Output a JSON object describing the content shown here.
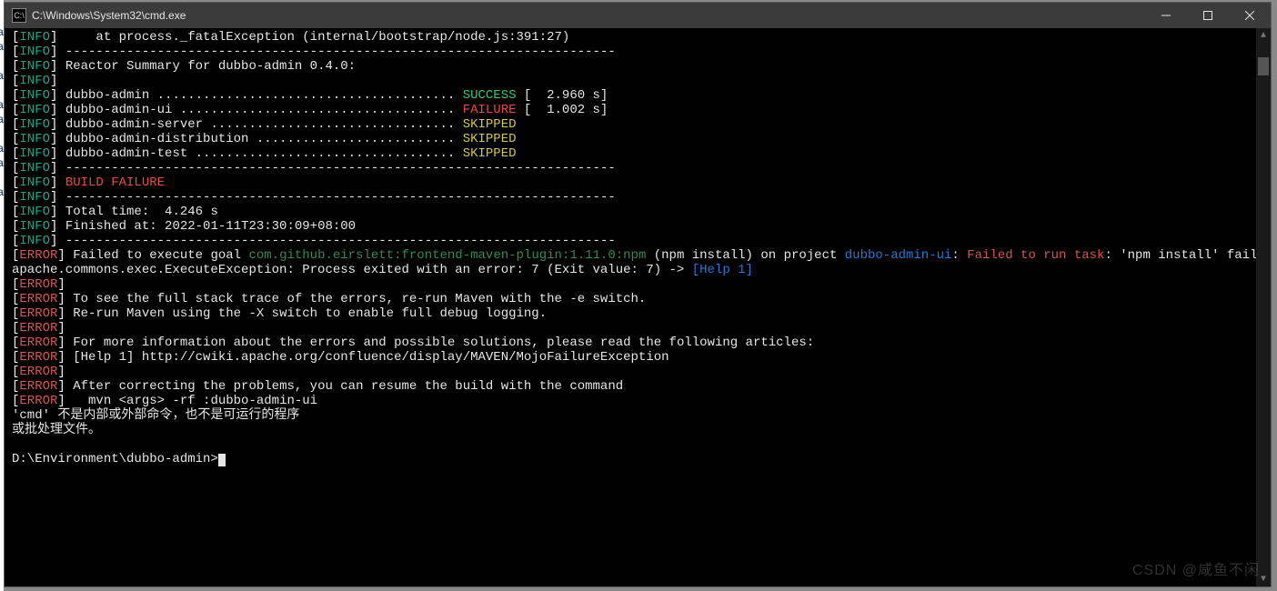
{
  "window": {
    "title": "C:\\Windows\\System32\\cmd.exe",
    "icon_label": "C:\\"
  },
  "tags": {
    "info_open": "[",
    "info": "INFO",
    "info_close": "]",
    "error_open": "[",
    "error": "ERROR",
    "error_close": "]"
  },
  "lines": {
    "l1": "     at process._fatalException (internal/bootstrap/node.js:391:27)",
    "l3": " Reactor Summary for dubbo-admin 0.4.0:",
    "mod1_name": " dubbo-admin ....................................... ",
    "mod1_status": "SUCCESS",
    "mod1_time": " [  2.960 s]",
    "mod2_name": " dubbo-admin-ui .................................... ",
    "mod2_status": "FAILURE",
    "mod2_time": " [  1.002 s]",
    "mod3_name": " dubbo-admin-server ................................ ",
    "mod3_status": "SKIPPED",
    "mod4_name": " dubbo-admin-distribution .......................... ",
    "mod4_status": "SKIPPED",
    "mod5_name": " dubbo-admin-test .................................. ",
    "mod5_status": "SKIPPED",
    "sep": " ------------------------------------------------------------------------",
    "build_failure": " BUILD FAILURE",
    "total_time": " Total time:  4.246 s",
    "finished_at": " Finished at: 2022-01-11T23:30:09+08:00",
    "err1_a": " Failed to execute goal ",
    "err1_plugin": "com.github.eirslett:frontend-maven-plugin:1.11.0:npm",
    "err1_b": " (npm install) on project ",
    "err1_project": "dubbo-admin-ui",
    "err1_c": ": ",
    "err1_task": "Failed to run task",
    "err1_d": ": 'npm install' failed. org.",
    "err1_line2a": "apache.commons.exec.ExecuteException: Process exited with an error: 7 (Exit value: 7) -> ",
    "err1_help": "[Help 1]",
    "err_trace": " To see the full stack trace of the errors, re-run Maven with the -e switch.",
    "err_debug": " Re-run Maven using the -X switch to enable full debug logging.",
    "err_more": " For more information about the errors and possible solutions, please read the following articles:",
    "err_help1": " [Help 1] http://cwiki.apache.org/confluence/display/MAVEN/MojoFailureException",
    "err_resume": " After correcting the problems, you can resume the build with the command",
    "err_cmd": "   mvn <args> -rf :dubbo-admin-ui",
    "cn1": "'cmd' 不是内部或外部命令，也不是可运行的程序",
    "cn2": "或批处理文件。",
    "prompt": "D:\\Environment\\dubbo-admin>"
  },
  "watermark": "CSDN @咸鱼不闲"
}
